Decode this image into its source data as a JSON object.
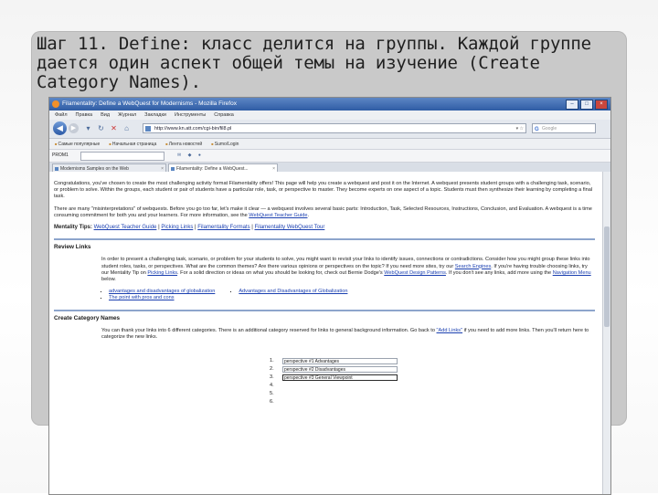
{
  "slide": {
    "title": "Шаг 11. Define: класс делится на группы. Каждой группе дается один аспект общей темы на изучение (Create Category Names)."
  },
  "browser": {
    "window_title": "Filamentality: Define a WebQuest for Modernisms - Mozilla Firefox",
    "menu": [
      "Файл",
      "Правка",
      "Вид",
      "Журнал",
      "Закладки",
      "Инструменты",
      "Справка"
    ],
    "url": "http://www.kn.att.com/cgi-bin/fil8.pl",
    "search_placeholder": "Google",
    "bookmarks": [
      "Самые популярные",
      "Начальная страница",
      "Лента новостей",
      "Sumo/Login"
    ],
    "addon_label": "PROM1",
    "tabs": [
      {
        "label": "Modernisms Samples on the Web"
      },
      {
        "label": "Filamentality: Define a WebQuest..."
      }
    ]
  },
  "page": {
    "intro_p1": "Congratulations, you've chosen to create the most challenging activity format Filamentality offers! This page will help you create a webquest and post it on the Internet. A webquest presents student groups with a challenging task, scenario, or problem to solve. Within the groups, each student or pair of students have a particular role, task, or perspective to master. They become experts on one aspect of a topic. Students must then synthesize their learning by completing a final task.",
    "intro_p2_a": "There are many \"misinterpretations\" of webquests. Before you go too far, let's make it clear — a webquest involves several basic parts: Introduction, Task, Selected Resources, Instructions, Conclusion, and Evaluation. A webquest is a time consuming commitment for both you and your learners. For more information, see the",
    "intro_p2_link": "WebQuest Teacher Guide",
    "tips_label": "Mentality Tips:",
    "tips_links": [
      "WebQuest Teacher Guide",
      "Picking Links",
      "Filamentality Formats",
      "Filamentality WebQuest Tour"
    ],
    "review_title": "Review Links",
    "review_text_a": "In order to present a challenging task, scenario, or problem for your students to solve, you might want to revisit your links to identify issues, connections or contradictions. Consider how you might group these links into student roles, tasks, or perspectives. What are the common themes? Are there various opinions or perspectives on the topic? If you need more sites, try our",
    "review_link1": "Search Engines",
    "review_text_b": ". If you're having trouble choosing links, try our Mentality Tip on",
    "review_link2": "Picking Links",
    "review_text_c": ". For a solid direction or ideas on what you should be looking for, check out Bernie Dodge's",
    "review_link3": "WebQuest Design Patterns",
    "review_text_d": ". If you don't see any links, add more using the",
    "review_link4": "Navigation Menu",
    "review_text_e": "below.",
    "review_links_col1": [
      "advantages and disadvantages of globalization",
      "The point with pros and cons"
    ],
    "review_links_col2": [
      "Advantages and Disadvantages of Globalization"
    ],
    "create_title": "Create Category Names",
    "create_text_a": "You can thank your links into 6 different categories. There is an additional category reserved for links to general background information. Go back to",
    "create_link": "\"Add Links\"",
    "create_text_b": "if you need to add more links. Then you'll return here to categorize the new links.",
    "categories": [
      {
        "num": "1.",
        "value": "perspective #1 Advantages"
      },
      {
        "num": "2.",
        "value": "perspective #2 Disadvantages"
      },
      {
        "num": "3.",
        "value": "perspective #3 General Viewpoint"
      },
      {
        "num": "4.",
        "value": ""
      },
      {
        "num": "5.",
        "value": ""
      },
      {
        "num": "6.",
        "value": ""
      }
    ]
  }
}
